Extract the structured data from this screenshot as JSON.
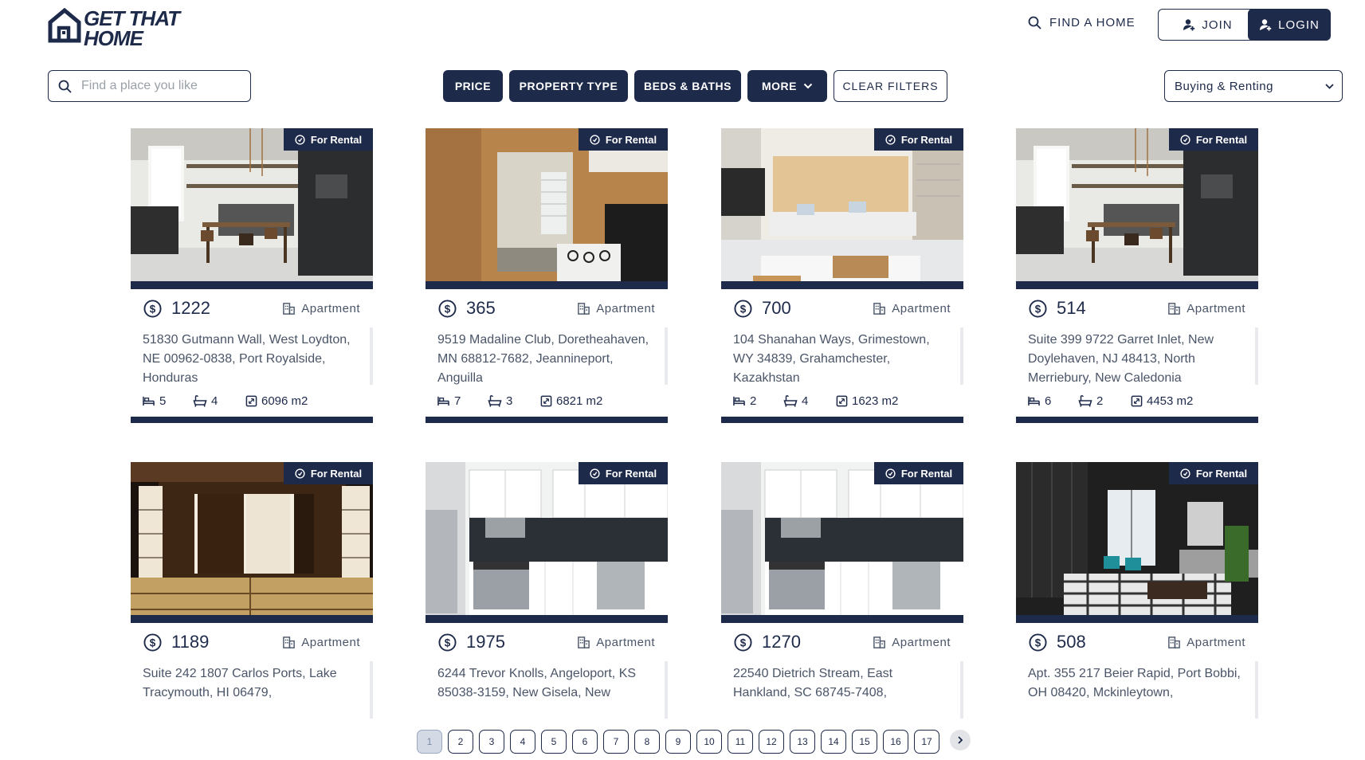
{
  "brand": {
    "line1": "GET THAT",
    "line2": "HOME"
  },
  "nav": {
    "find_label": "FIND A HOME",
    "join_label": "JOIN",
    "login_label": "LOGIN"
  },
  "filters": {
    "search_placeholder": "Find a place you like",
    "price": "PRICE",
    "property_type": "PROPERTY TYPE",
    "beds_baths": "BEDS & BATHS",
    "more": "MORE",
    "clear": "CLEAR FILTERS",
    "mode_selected": "Buying & Renting"
  },
  "colors": {
    "primary": "#1e2a4a",
    "muted": "#4a5568",
    "pager_active": "#d3dae6"
  },
  "listings": [
    {
      "badge": "For Rental",
      "price": "1222",
      "type": "Apartment",
      "address": "51830 Gutmann Wall, West Loydton, NE 00962-0838, Port Royalside, Honduras",
      "beds": "5",
      "baths": "4",
      "area": "6096 m2",
      "photo": "kitchen-dining"
    },
    {
      "badge": "For Rental",
      "price": "365",
      "type": "Apartment",
      "address": "9519 Madaline Club, Doretheahaven, MN 68812-7682, Jeannineport, Anguilla",
      "beds": "7",
      "baths": "3",
      "area": "6821 m2",
      "photo": "empty-room-stove"
    },
    {
      "badge": "For Rental",
      "price": "700",
      "type": "Apartment",
      "address": "104 Shanahan Ways, Grimestown, WY 34839, Grahamchester, Kazakhstan",
      "beds": "2",
      "baths": "4",
      "area": "1623 m2",
      "photo": "living-room"
    },
    {
      "badge": "For Rental",
      "price": "514",
      "type": "Apartment",
      "address": "Suite 399 9722 Garret Inlet, New Doylehaven, NJ 48413, North Merriebury, New Caledonia",
      "beds": "6",
      "baths": "2",
      "area": "4453 m2",
      "photo": "kitchen-dining"
    },
    {
      "badge": "For Rental",
      "price": "1189",
      "type": "Apartment",
      "address": "Suite 242 1807 Carlos Ports, Lake Tracymouth, HI 06479,",
      "beds": "",
      "baths": "",
      "area": "",
      "photo": "japanese-room"
    },
    {
      "badge": "For Rental",
      "price": "1975",
      "type": "Apartment",
      "address": "6244 Trevor Knolls, Angeloport, KS 85038-3159, New Gisela, New",
      "beds": "",
      "baths": "",
      "area": "",
      "photo": "white-kitchen"
    },
    {
      "badge": "For Rental",
      "price": "1270",
      "type": "Apartment",
      "address": "22540 Dietrich Stream, East Hankland, SC 68745-7408,",
      "beds": "",
      "baths": "",
      "area": "",
      "photo": "white-kitchen"
    },
    {
      "badge": "For Rental",
      "price": "508",
      "type": "Apartment",
      "address": "Apt. 355 217 Beier Rapid, Port Bobbi, OH 08420, Mckinleytown,",
      "beds": "",
      "baths": "",
      "area": "",
      "photo": "dark-living-room"
    }
  ],
  "pagination": {
    "current": "1",
    "pages": [
      "1",
      "2",
      "3",
      "4",
      "5",
      "6",
      "7",
      "8",
      "9",
      "10",
      "11",
      "12",
      "13",
      "14",
      "15",
      "16",
      "17"
    ]
  }
}
